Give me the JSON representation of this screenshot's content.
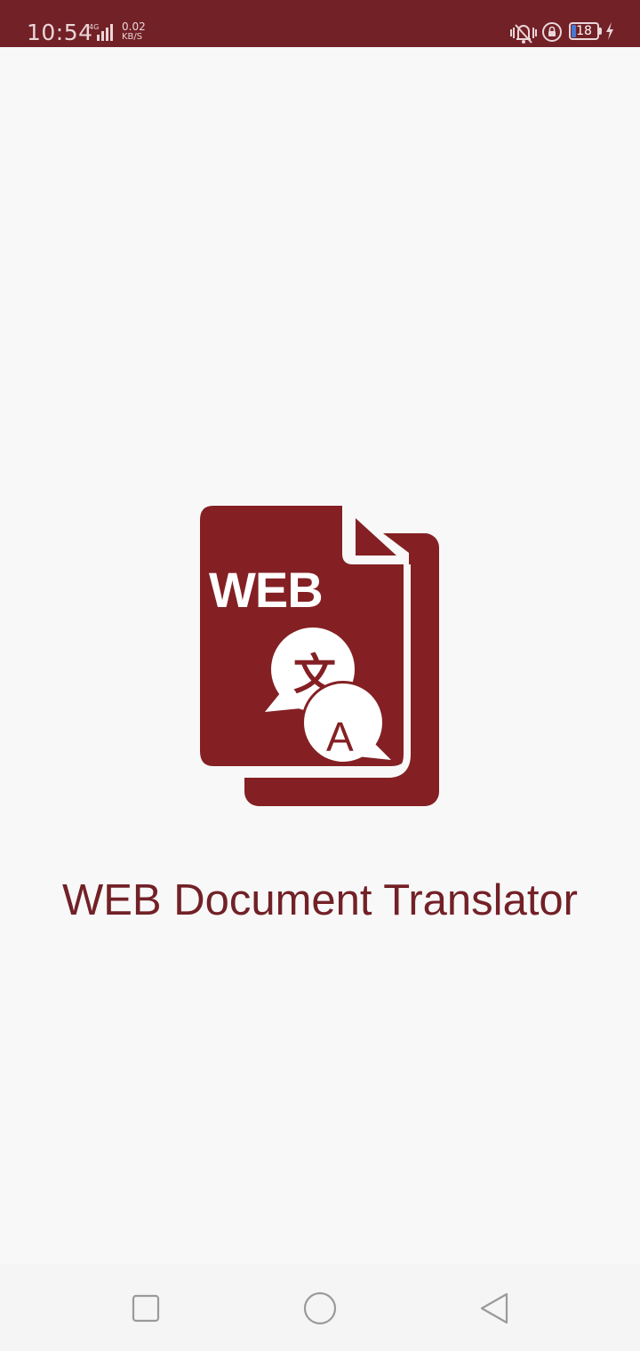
{
  "status_bar": {
    "time": "10:54",
    "network_type": "4G",
    "speed_value": "0.02",
    "speed_unit": "KB/S",
    "battery_level": "18",
    "icons": [
      "signal-icon",
      "vibrate-icon",
      "rotation-lock-icon",
      "battery-icon",
      "charging-icon"
    ]
  },
  "splash": {
    "logo_text": "WEB",
    "translate_glyph_top": "文",
    "translate_glyph_bottom": "A",
    "title": "WEB Document Translator"
  },
  "nav_bar": {
    "buttons": [
      "recent-apps",
      "home",
      "back"
    ]
  },
  "colors": {
    "primary": "#722127",
    "logo": "#842024",
    "background": "#f8f8f8",
    "battery_fill": "#4a78d2"
  }
}
